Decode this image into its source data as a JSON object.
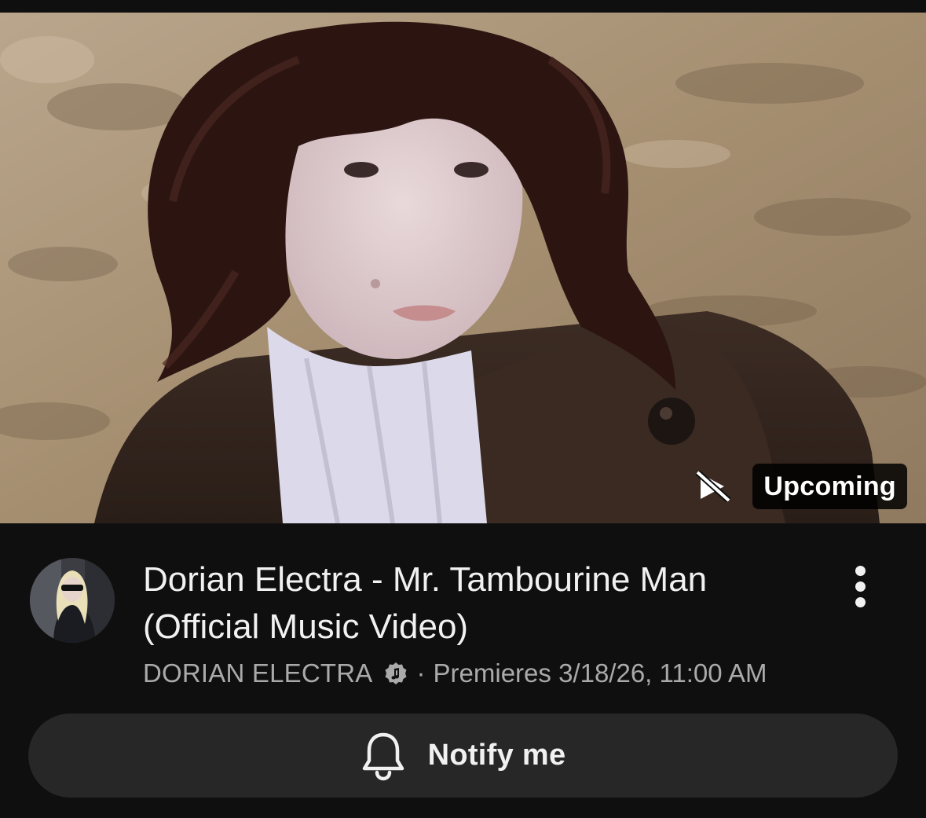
{
  "video": {
    "thumbnail": "music-video-thumbnail",
    "badge": "Upcoming",
    "badge_icon": "not-playing-icon",
    "title": "Dorian Electra - Mr. Tambourine Man (Official Music Video)",
    "channel": "DORIAN ELECTRA",
    "channel_badge_icon": "music-note-icon",
    "separator": "·",
    "premiere": "Premieres 3/18/26, 11:00 AM",
    "more_icon": "more-vert-icon"
  },
  "actions": {
    "notify_label": "Notify me",
    "notify_icon": "bell-icon"
  },
  "colors": {
    "background": "#0f0f0f",
    "button_bg": "#272727",
    "primary_text": "#f1f1f1",
    "secondary_text": "#aaaaaa"
  }
}
